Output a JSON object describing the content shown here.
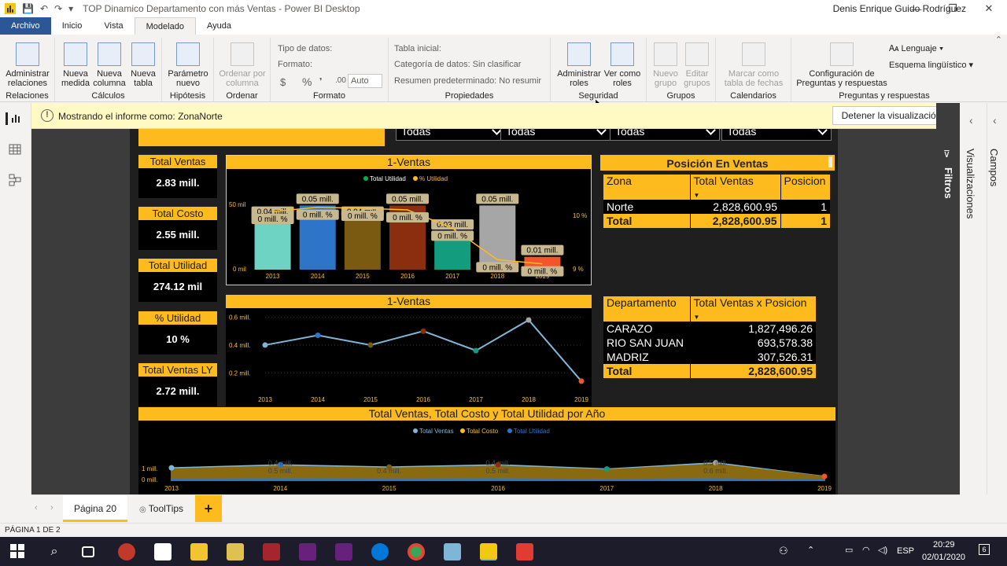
{
  "window": {
    "title": "TOP Dinamico Departamento con más Ventas - Power BI Desktop",
    "user": "Denis Enrique Guido Rodríguez",
    "controls": [
      "—",
      "❐",
      "✕"
    ]
  },
  "ribbon_tabs": [
    "Archivo",
    "Inicio",
    "Vista",
    "Modelado",
    "Ayuda"
  ],
  "ribbon": {
    "relaciones": {
      "btn": "Administrar relaciones",
      "group": "Relaciones"
    },
    "calculos": {
      "b1": "Nueva medida",
      "b2": "Nueva columna",
      "b3": "Nueva tabla",
      "group": "Cálculos"
    },
    "hipotesis": {
      "b1": "Parámetro nuevo",
      "group": "Hipótesis"
    },
    "ordenar": {
      "b1": "Ordenar por columna",
      "group": "Ordenar"
    },
    "formato": {
      "tipo": "Tipo de datos:",
      "formato": "Formato:",
      "moneda": "$",
      "pct": "%",
      "mil": "❜",
      "dec": ".00",
      "auto": "Auto",
      "group": "Formato"
    },
    "propiedades": {
      "tabla": "Tabla inicial:",
      "categoria": "Categoría de datos: Sin clasificar",
      "resumen": "Resumen predeterminado: No resumir",
      "group": "Propiedades"
    },
    "seguridad": {
      "b1": "Administrar roles",
      "b2": "Ver como roles",
      "group": "Seguridad"
    },
    "grupos": {
      "b1": "Nuevo grupo",
      "b2": "Editar grupos",
      "group": "Grupos"
    },
    "calendarios": {
      "b1": "Marcar como tabla de fechas",
      "group": "Calendarios"
    },
    "preguntas": {
      "b1": "Configuración de Preguntas y respuestas",
      "lenguaje": "Lenguaje",
      "esquema": "Esquema lingüístico",
      "group": "Preguntas y respuestas"
    }
  },
  "banner": {
    "message": "Mostrando el informe como: ZonaNorte",
    "stop_button": "Detener la visualización"
  },
  "slicers": [
    "Todas",
    "Todas",
    "Todas",
    "Todas"
  ],
  "kpis": [
    {
      "label": "Total Ventas",
      "value": "2.83 mill."
    },
    {
      "label": "Total Costo",
      "value": "2.55 mill."
    },
    {
      "label": "Total Utilidad",
      "value": "274.12 mil"
    },
    {
      "label": "% Utilidad",
      "value": "10 %"
    },
    {
      "label": "Total Ventas LY",
      "value": "2.72 mill."
    }
  ],
  "posicion_table": {
    "title": "Posición En Ventas",
    "headers": [
      "Zona",
      "Total Ventas",
      "Posicion"
    ],
    "rows": [
      [
        "Norte",
        "2,828,600.95",
        "1"
      ]
    ],
    "total": [
      "Total",
      "2,828,600.95",
      "1"
    ]
  },
  "departamento_table": {
    "headers": [
      "Departamento",
      "Total Ventas x Posicion"
    ],
    "rows": [
      [
        "CARAZO",
        "1,827,496.26"
      ],
      [
        "RIO SAN JUAN",
        "693,578.38"
      ],
      [
        "MADRIZ",
        "307,526.31"
      ]
    ],
    "total": [
      "Total",
      "2,828,600.95"
    ]
  },
  "pages": {
    "tab1": "Página 20",
    "tab2": "ToolTips",
    "add": "+",
    "status": "PÁGINA 1 DE 2"
  },
  "panes": {
    "filtros": "Filtros",
    "visualizaciones": "Visualizaciones",
    "campos": "Campos"
  },
  "tray": {
    "lang": "ESP",
    "time": "20:29",
    "date": "02/01/2020",
    "notif": "6"
  },
  "colors": {
    "accent": "#fdbb1e",
    "report_bg": "#1f1f1f",
    "banner": "#fff9c4"
  },
  "chart_data": [
    {
      "type": "bar",
      "title": "1-Ventas",
      "categories": [
        "2013",
        "2014",
        "2015",
        "2016",
        "2017",
        "2018",
        "2019"
      ],
      "series": [
        {
          "name": "Total Utilidad",
          "type": "bar",
          "values": [
            0.04,
            0.05,
            0.04,
            0.05,
            0.03,
            0.05,
            0.01
          ],
          "data_labels": [
            "0.04 mill.",
            "0.05 mill.",
            "0.04 mill.",
            "0.05 mill.",
            "0.03 mill.",
            "0.05 mill.",
            "0.01 mill."
          ],
          "colors": [
            "#6fd3c4",
            "#2e75c9",
            "#7a5a10",
            "#8b2e10",
            "#139c7d",
            "#a6a6a6",
            "#f2552a"
          ]
        },
        {
          "name": "% Utilidad",
          "type": "line",
          "values": [
            10.02,
            10.1,
            10.08,
            10.05,
            9.7,
            9.1,
            9.02
          ],
          "data_labels": [
            "0 mill. %",
            "0 mill. %",
            "0 mill. %",
            "0 mill. %",
            "0 mill. %",
            "0 mill. %",
            "0 mill. %"
          ]
        }
      ],
      "y_ticks": [
        "50 mil",
        "0 mil"
      ],
      "y2_ticks": [
        "10 %",
        "9 %"
      ],
      "ylim": [
        0,
        0.06
      ],
      "y2lim": [
        9,
        10.2
      ],
      "legend": "top-center"
    },
    {
      "type": "line",
      "title": "1-Ventas",
      "categories": [
        "2013",
        "2014",
        "2015",
        "2016",
        "2017",
        "2018",
        "2019"
      ],
      "series": [
        {
          "values": [
            0.4,
            0.47,
            0.4,
            0.5,
            0.36,
            0.58,
            0.14
          ],
          "point_colors": [
            "#7fb5d6",
            "#2e75c9",
            "#7a5a10",
            "#8b2e10",
            "#139c7d",
            "#a6a6a6",
            "#f2552a"
          ]
        }
      ],
      "y_ticks": [
        "0.6 mill.",
        "0.4 mill.",
        "0.2 mill."
      ],
      "ylim": [
        0.1,
        0.62
      ]
    },
    {
      "type": "area",
      "title": "Total Ventas, Total Costo y Total Utilidad por Año",
      "categories": [
        "2013",
        "2014",
        "2015",
        "2016",
        "2017",
        "2018",
        "2019"
      ],
      "series": [
        {
          "name": "Total Ventas",
          "color": "#7fb5d6",
          "values": [
            0.44,
            0.55,
            0.47,
            0.55,
            0.4,
            0.62,
            0.14
          ]
        },
        {
          "name": "Total Costo",
          "color": "#fdbb1e",
          "values": [
            0.4,
            0.5,
            0.43,
            0.5,
            0.37,
            0.57,
            0.13
          ]
        },
        {
          "name": "Total Utilidad",
          "color": "#2e75c9",
          "values": [
            0.04,
            0.05,
            0.04,
            0.05,
            0.03,
            0.05,
            0.01
          ]
        }
      ],
      "data_labels": [
        {
          "text": "0.4 mill."
        },
        {
          "text": "0.5 mill."
        },
        {
          "text": "0.4 mill."
        },
        {
          "text": "0.4 mill."
        },
        {
          "text": "0.5 mill."
        },
        {
          "text": "0.5 mill."
        },
        {
          "text": "0.6 mill."
        }
      ],
      "y_ticks": [
        "1 mill.",
        "0 mill."
      ],
      "legend": "top-center"
    }
  ]
}
